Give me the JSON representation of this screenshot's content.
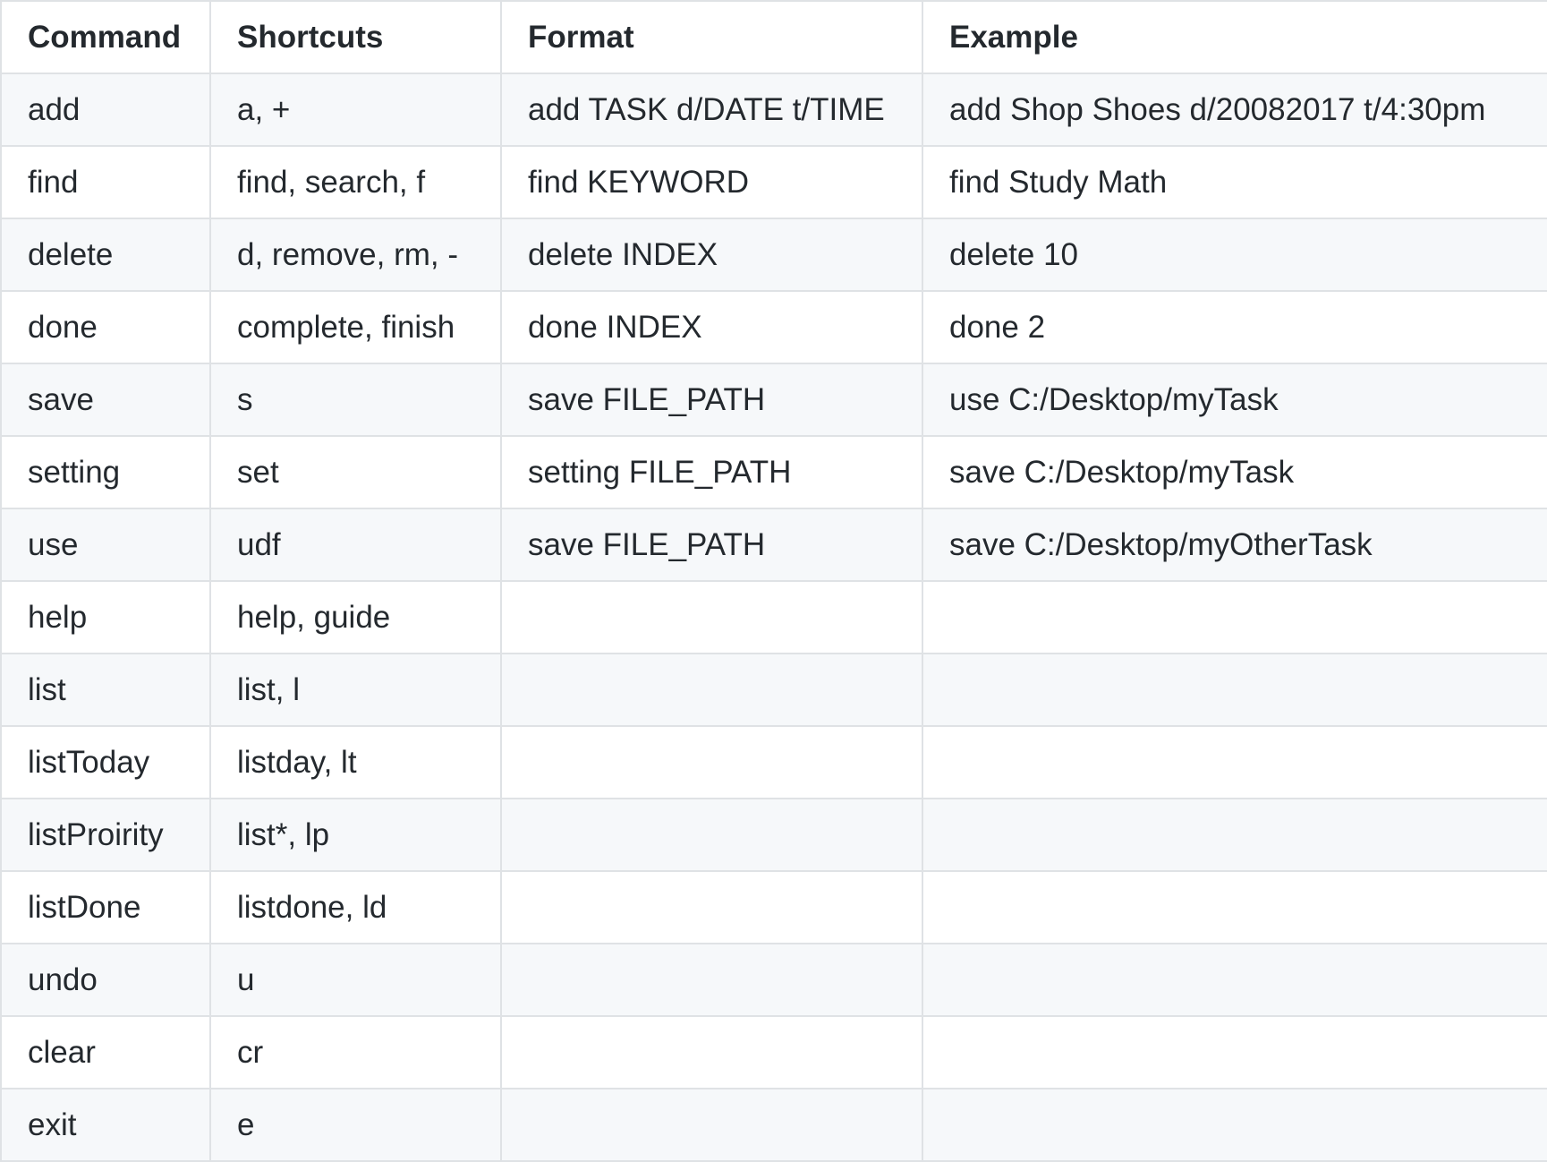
{
  "table": {
    "headers": [
      "Command",
      "Shortcuts",
      "Format",
      "Example"
    ],
    "rows": [
      [
        "add",
        "a, +",
        "add TASK d/DATE t/TIME",
        "add Shop Shoes d/20082017 t/4:30pm"
      ],
      [
        "find",
        "find, search, f",
        "find KEYWORD",
        "find Study Math"
      ],
      [
        "delete",
        "d, remove, rm, -",
        "delete INDEX",
        "delete 10"
      ],
      [
        "done",
        "complete, finish",
        "done INDEX",
        "done 2"
      ],
      [
        "save",
        "s",
        "save FILE_PATH",
        "use C:/Desktop/myTask"
      ],
      [
        "setting",
        "set",
        "setting FILE_PATH",
        "save C:/Desktop/myTask"
      ],
      [
        "use",
        "udf",
        "save FILE_PATH",
        "save C:/Desktop/myOtherTask"
      ],
      [
        "help",
        "help, guide",
        "",
        ""
      ],
      [
        "list",
        "list, l",
        "",
        ""
      ],
      [
        "listToday",
        "listday, lt",
        "",
        ""
      ],
      [
        "listProirity",
        "list*, lp",
        "",
        ""
      ],
      [
        "listDone",
        "listdone, ld",
        "",
        ""
      ],
      [
        "undo",
        "u",
        "",
        ""
      ],
      [
        "clear",
        "cr",
        "",
        ""
      ],
      [
        "exit",
        "e",
        "",
        ""
      ]
    ]
  }
}
